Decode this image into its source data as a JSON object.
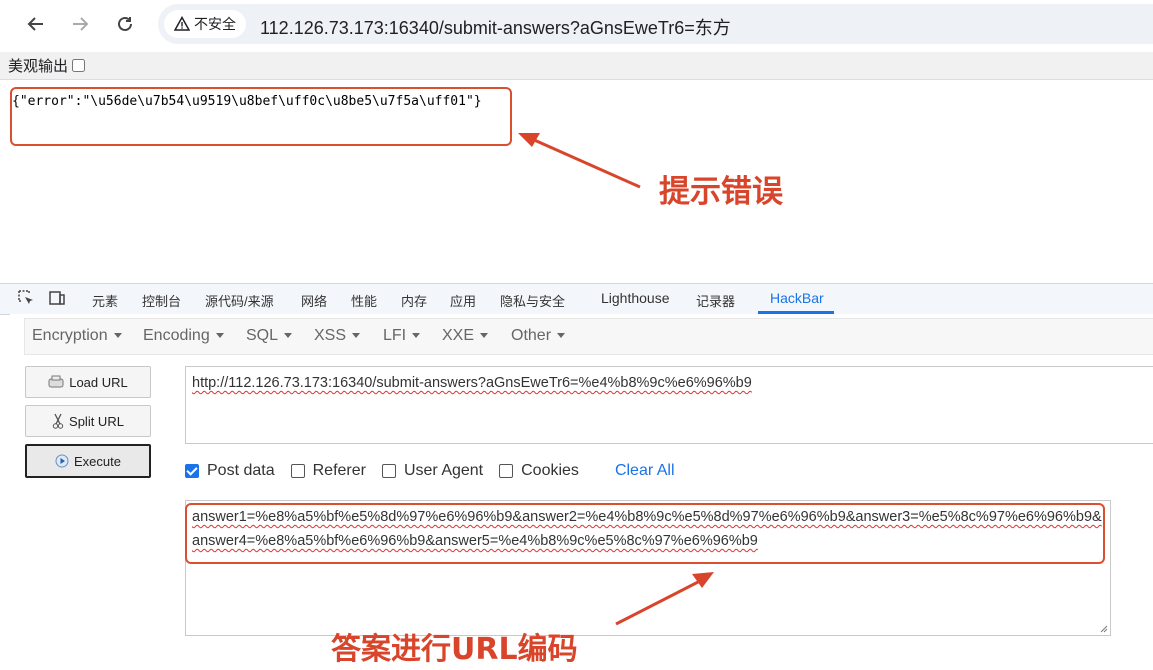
{
  "browser": {
    "security_label": "不安全",
    "url": "112.126.73.173:16340/submit-answers?aGnsEweTr6=东方"
  },
  "pretty_print": {
    "label": "美观输出",
    "checked": false
  },
  "response_text": "{\"error\":\"\\u56de\\u7b54\\u9519\\u8bef\\uff0c\\u8be5\\u7f5a\\uff01\"}",
  "annotations": {
    "error_hint": "提示错误",
    "encoding_hint": "答案进行URL编码",
    "color": "#d9452b"
  },
  "devtools": {
    "tabs": [
      "元素",
      "控制台",
      "源代码/来源",
      "网络",
      "性能",
      "内存",
      "应用",
      "隐私与安全",
      "Lighthouse",
      "记录器",
      "HackBar"
    ],
    "active_tab": "HackBar"
  },
  "hackbar": {
    "menu": [
      "Encryption",
      "Encoding",
      "SQL",
      "XSS",
      "LFI",
      "XXE",
      "Other"
    ],
    "buttons": {
      "load_url": "Load URL",
      "split_url": "Split URL",
      "execute": "Execute"
    },
    "url_value": "http://112.126.73.173:16340/submit-answers?aGnsEweTr6=%e4%b8%9c%e6%96%b9",
    "options": {
      "post_data": {
        "label": "Post data",
        "checked": true
      },
      "referer": {
        "label": "Referer",
        "checked": false
      },
      "user_agent": {
        "label": "User Agent",
        "checked": false
      },
      "cookies": {
        "label": "Cookies",
        "checked": false
      },
      "clear_all": "Clear All"
    },
    "post_value": "answer1=%e8%a5%bf%e5%8d%97%e6%96%b9&answer2=%e4%b8%9c%e5%8d%97%e6%96%b9&answer3=%e5%8c%97%e6%96%b9&answer4=%e8%a5%bf%e6%96%b9&answer5=%e4%b8%9c%e5%8c%97%e6%96%b9"
  }
}
